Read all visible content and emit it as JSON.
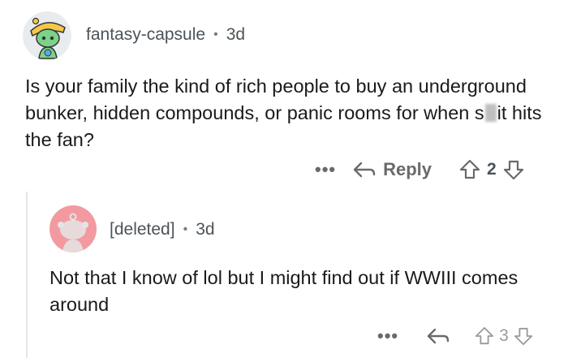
{
  "comment1": {
    "username": "fantasy-capsule",
    "separator": "•",
    "time": "3d",
    "body_part1": "Is your family the kind of rich people to buy an underground bunker, hidden compounds, or panic rooms for when s",
    "body_part2": "it hits the fan?",
    "more_label": "•••",
    "reply_label": "Reply",
    "votes": "2"
  },
  "comment2": {
    "username": "[deleted]",
    "separator": "•",
    "time": "3d",
    "body": "Not that I know of lol but I might find out if WWIII comes around",
    "more_label": "•••",
    "votes": "3"
  },
  "colors": {
    "text": "#1a1a1b",
    "meta": "#4c5358",
    "avatar_deleted": "#f29aa0",
    "thread_line": "#e5e5e5"
  }
}
